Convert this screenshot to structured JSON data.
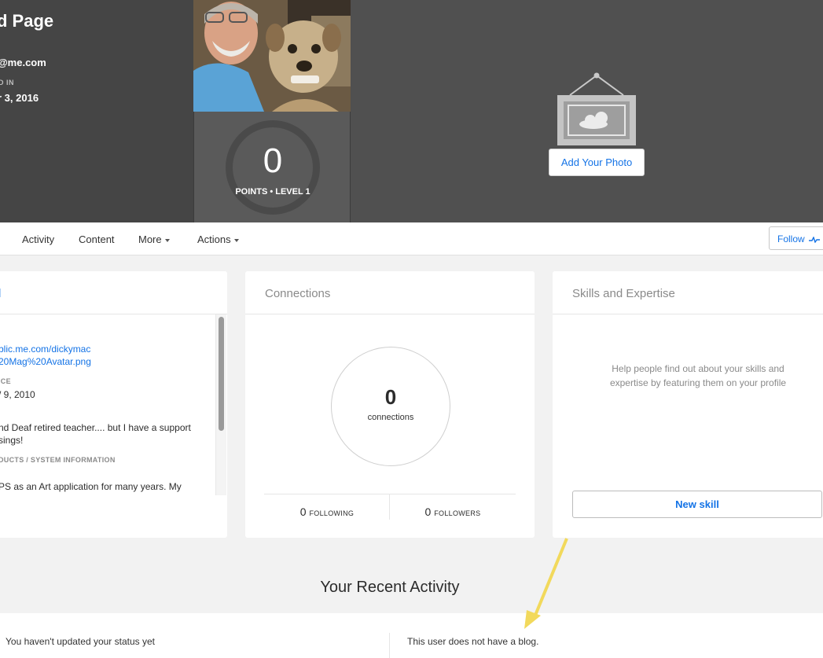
{
  "profile": {
    "name": "d Page",
    "email": "@me.com",
    "joined_label": "D IN",
    "joined_date": "r 3, 2016"
  },
  "points": {
    "value": "0",
    "label": "POINTS • LEVEL 1"
  },
  "cover": {
    "add_photo_label": "Add Your Photo",
    "icon": "picture-frame-icon"
  },
  "nav": {
    "activity": "Activity",
    "content": "Content",
    "more": "More",
    "actions": "Actions",
    "follow": "Follow"
  },
  "about": {
    "title": "l",
    "url_line1": "blic.me.com/dickymac",
    "url_line2": "20Mag%20Avatar.png",
    "since_label": "ICE",
    "since_value": "/ 9, 2010",
    "bio_line1": "nd Deaf retired teacher.... but I have a support",
    "bio_line2": "sings!",
    "products_label": "DUCTS / SYSTEM INFORMATION",
    "products_line1": "PS as an Art application for many years. My"
  },
  "connections": {
    "title": "Connections",
    "count": "0",
    "count_label": "connections",
    "following_count": "0",
    "following_label": "FOLLOWING",
    "followers_count": "0",
    "followers_label": "FOLLOWERS"
  },
  "skills": {
    "title": "Skills and Expertise",
    "help": "Help people find out about your skills and expertise by featuring them on your profile",
    "new_skill": "New skill"
  },
  "activity": {
    "title": "Your Recent Activity",
    "status": "You haven't updated your status yet",
    "blog": "This user does not have a blog."
  },
  "colors": {
    "accent": "#1473e6",
    "header_bg": "#4f4f4f",
    "annotation_arrow": "#f2d95c"
  }
}
